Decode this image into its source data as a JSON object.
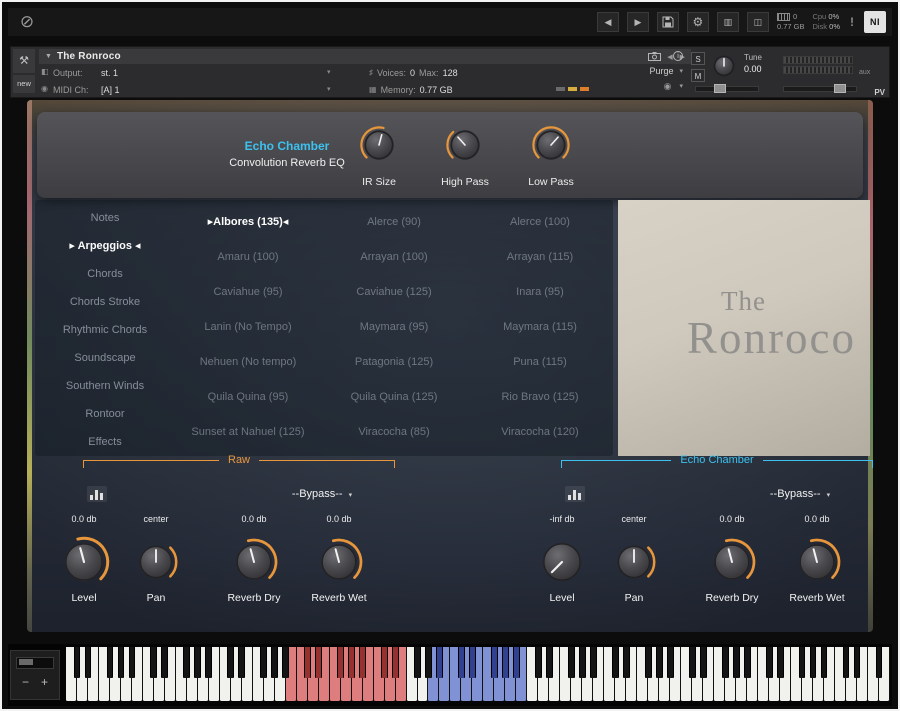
{
  "colors": {
    "orange": "#e8963c",
    "cyan": "#3cc1f0"
  },
  "icons": {
    "power": "⊘",
    "back": "◀",
    "forward": "▶",
    "gear": "⚙",
    "mixer": "▥",
    "output_window": "◫",
    "collapse": "▼",
    "dropdown": "▾",
    "left_small": "◀",
    "right_small": "▶",
    "wrench": "⚒",
    "output": "◧",
    "midi": "◉",
    "voices": "♯",
    "memory_rows": "▦",
    "info": "i",
    "selected_left": "▸",
    "selected_right": "◂"
  },
  "top_toolbar": {
    "notes_value": "0",
    "mem_value": "0.77 GB",
    "cpu_label": "Cpu",
    "cpu_value": "0%",
    "disk_label": "Disk",
    "disk_value": "0%",
    "alert": "!",
    "logo": "NI"
  },
  "rack_header": {
    "title": "The Ronroco",
    "new_label": "new",
    "output_label": "Output:",
    "output_value": "st. 1",
    "midi_label": "MIDI Ch:",
    "midi_value": "[A] 1",
    "voices_label": "Voices:",
    "voices_value": "0",
    "max_label": "Max:",
    "max_value": "128",
    "memory_label": "Memory:",
    "memory_value": "0.77 GB",
    "purge_label": "Purge",
    "solo_label": "S",
    "mute_label": "M",
    "tune_label": "Tune",
    "tune_value": "0.00",
    "aux_label": "aux",
    "pv_label": "PV"
  },
  "fx_header": {
    "title": "Echo Chamber",
    "subtitle": "Convolution Reverb EQ",
    "knobs": [
      {
        "label": "IR Size",
        "angle": 15,
        "arc_start": -135,
        "arc_end": 15
      },
      {
        "label": "High Pass",
        "angle": -42,
        "arc_start": -135,
        "arc_end": -42
      },
      {
        "label": "Low Pass",
        "angle": 42,
        "arc_start": -135,
        "arc_end": 135
      }
    ]
  },
  "sidebar": {
    "items": [
      {
        "label": "Notes",
        "selected": false
      },
      {
        "label": "Arpeggios",
        "selected": true
      },
      {
        "label": "Chords",
        "selected": false
      },
      {
        "label": "Chords Stroke",
        "selected": false
      },
      {
        "label": "Rhythmic Chords",
        "selected": false
      },
      {
        "label": "Soundscape",
        "selected": false
      },
      {
        "label": "Southern Winds",
        "selected": false
      },
      {
        "label": "Rontoor",
        "selected": false
      },
      {
        "label": "Effects",
        "selected": false
      }
    ]
  },
  "presets": {
    "items": [
      {
        "label": "Albores (135)",
        "selected": true
      },
      {
        "label": "Alerce (90)",
        "selected": false
      },
      {
        "label": "Alerce (100)",
        "selected": false
      },
      {
        "label": "Amaru (100)",
        "selected": false
      },
      {
        "label": "Arrayan (100)",
        "selected": false
      },
      {
        "label": "Arrayan (115)",
        "selected": false
      },
      {
        "label": "Caviahue (95)",
        "selected": false
      },
      {
        "label": "Caviahue (125)",
        "selected": false
      },
      {
        "label": "Inara (95)",
        "selected": false
      },
      {
        "label": "Lanin (No Tempo)",
        "selected": false
      },
      {
        "label": "Maymara (95)",
        "selected": false
      },
      {
        "label": "Maymara (115)",
        "selected": false
      },
      {
        "label": "Nehuen (No tempo)",
        "selected": false
      },
      {
        "label": "Patagonia (125)",
        "selected": false
      },
      {
        "label": "Puna (115)",
        "selected": false
      },
      {
        "label": "Quila Quina (95)",
        "selected": false
      },
      {
        "label": "Quila Quina (125)",
        "selected": false
      },
      {
        "label": "Rio Bravo (125)",
        "selected": false
      },
      {
        "label": "Sunset at Nahuel (125)",
        "selected": false
      },
      {
        "label": "Viracocha (85)",
        "selected": false
      },
      {
        "label": "Viracocha (120)",
        "selected": false
      }
    ]
  },
  "branding": {
    "line1": "The",
    "line2": "Ronroco"
  },
  "mixer": {
    "channels": [
      {
        "name": "Raw",
        "accent": "#e8963c",
        "bypass": "--Bypass--",
        "knobs": [
          {
            "label": "Level",
            "value": "0.0 db",
            "angle": -15,
            "arc_start": -15,
            "arc_end": 135
          },
          {
            "label": "Pan",
            "value": "center",
            "angle": 0,
            "arc_start": 45,
            "arc_end": 135
          },
          {
            "label": "Reverb Dry",
            "value": "0.0 db",
            "angle": -15,
            "arc_start": -15,
            "arc_end": 135
          },
          {
            "label": "Reverb Wet",
            "value": "0.0 db",
            "angle": -15,
            "arc_start": -15,
            "arc_end": 135
          }
        ]
      },
      {
        "name": "Echo Chamber",
        "accent": "#3cc1f0",
        "bypass": "--Bypass--",
        "knobs": [
          {
            "label": "Level",
            "value": "-inf db",
            "angle": -135,
            "arc_start": 0,
            "arc_end": 0
          },
          {
            "label": "Pan",
            "value": "center",
            "angle": 0,
            "arc_start": 45,
            "arc_end": 135
          },
          {
            "label": "Reverb Dry",
            "value": "0.0 db",
            "angle": -15,
            "arc_start": -15,
            "arc_end": 135
          },
          {
            "label": "Reverb Wet",
            "value": "0.0 db",
            "angle": -15,
            "arc_start": -15,
            "arc_end": 135
          }
        ]
      }
    ]
  },
  "keyboard": {
    "white_keys": 75,
    "red_range": [
      20,
      30
    ],
    "blue_range": [
      33,
      41
    ],
    "minus_label": "−",
    "plus_label": "+"
  }
}
